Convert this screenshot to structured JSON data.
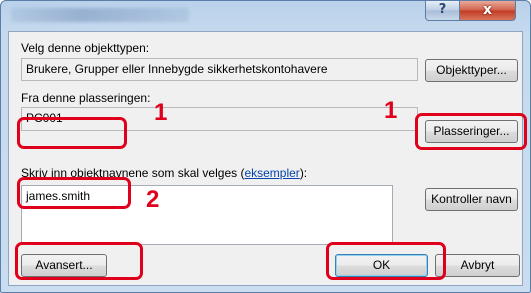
{
  "window": {
    "help_symbol": "?",
    "close_symbol": "x"
  },
  "object_type": {
    "label": "Velg denne objekttypen:",
    "value": "Brukere, Grupper eller Innebygde sikkerhetskontohavere",
    "button": "Objekttyper..."
  },
  "location": {
    "label": "Fra denne plasseringen:",
    "value": "PC001",
    "button": "Plasseringer..."
  },
  "names": {
    "label_prefix": "Skriv inn objektnavnene som skal velges (",
    "label_link": "eksempler",
    "label_suffix": "):",
    "value": "james.smith",
    "check_button": "Kontroller navn"
  },
  "footer": {
    "advanced_button": "Avansert...",
    "ok_button": "OK",
    "cancel_button": "Avbryt"
  },
  "callouts": {
    "marker_1": "1",
    "marker_2": "2"
  },
  "colors": {
    "highlight": "#e0001b",
    "link": "#0645ad"
  }
}
